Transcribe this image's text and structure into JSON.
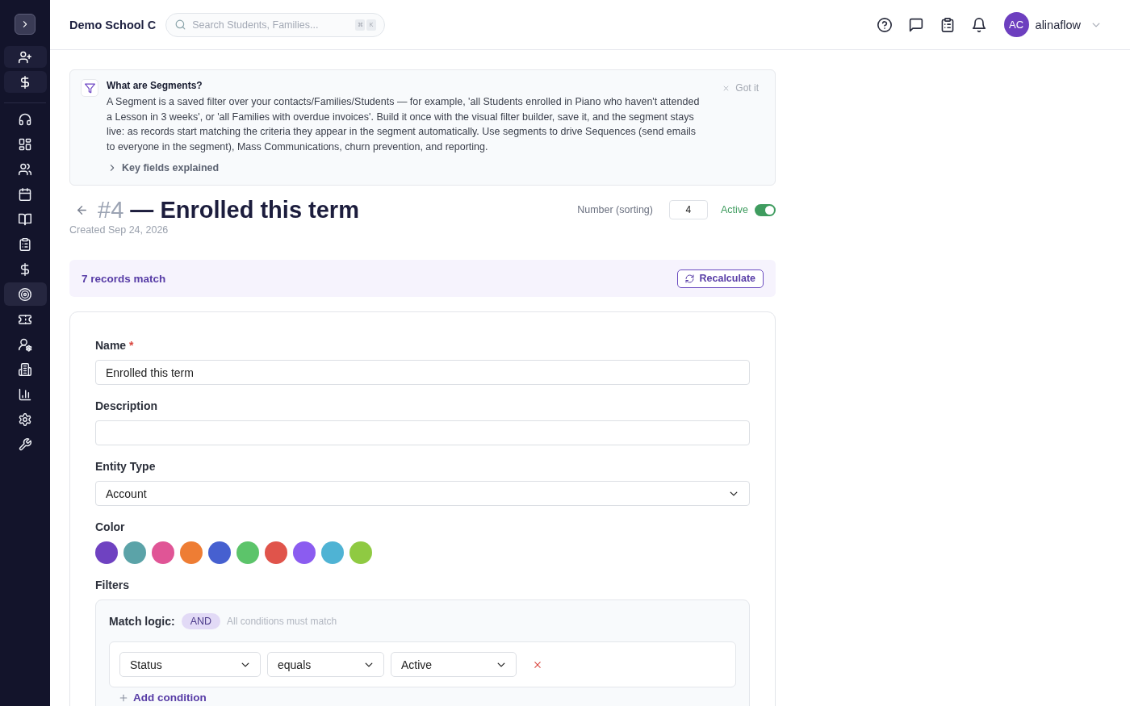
{
  "sidebar": {
    "items": [
      {
        "selected": false
      },
      {
        "selected": false
      },
      {
        "selected": false
      },
      {
        "selected": false
      },
      {
        "selected": false
      },
      {
        "selected": false
      },
      {
        "selected": false
      },
      {
        "selected": true
      },
      {
        "selected": false
      },
      {
        "selected": false
      },
      {
        "selected": false
      },
      {
        "selected": false
      },
      {
        "selected": false
      },
      {
        "selected": false
      }
    ]
  },
  "topbar": {
    "school_name": "Demo School C",
    "search": {
      "placeholder": "Search Students, Families...",
      "shortcut_keys": [
        "⌘",
        "K"
      ]
    },
    "user": {
      "initials": "AC",
      "name": "alinaflow"
    }
  },
  "info_panel": {
    "title": "What are Segments?",
    "body": "A Segment is a saved filter over your contacts/Families/Students — for example, 'all Students enrolled in Piano who haven't attended a Lesson in 3 weeks', or 'all Families with overdue invoices'. Build it once with the visual filter builder, save it, and the segment stays live: as records start matching the criteria they appear in the segment automatically. Use segments to drive Sequences (send emails to everyone in the segment), Mass Communications, churn prevention, and reporting.",
    "dismiss": "Got it",
    "details": {
      "label": "Key fields explained",
      "expanded": false
    }
  },
  "header": {
    "number": "#4",
    "title": "— Enrolled this term",
    "created": "Created Sep 24, 2026",
    "sort_number": {
      "label": "Number (sorting)",
      "value": "4"
    },
    "active": {
      "label": "Active",
      "on": true
    }
  },
  "match_bar": {
    "count_text": "7 records match",
    "button": "Recalculate"
  },
  "form": {
    "name": {
      "label": "Name",
      "required_mark": "*",
      "value": "Enrolled this term"
    },
    "description": {
      "label": "Description"
    },
    "entity_type": {
      "label": "Entity Type",
      "value": "Account"
    },
    "color": {
      "label": "Color",
      "swatches": [
        {
          "color": "#6f42c1",
          "selected": false
        },
        {
          "color": "#5ba3a8",
          "selected": false
        },
        {
          "color": "#e05596",
          "selected": false
        },
        {
          "color": "#ee7d34",
          "selected": false
        },
        {
          "color": "#4660d0",
          "selected": false
        },
        {
          "color": "#5cc46a",
          "selected": false
        },
        {
          "color": "#e0544b",
          "selected": false
        },
        {
          "color": "#8b5cf0",
          "selected": false
        },
        {
          "color": "#4fb3d4",
          "selected": false
        },
        {
          "color": "#8fca42",
          "selected": false
        }
      ]
    },
    "filters": {
      "label": "Filters",
      "match_logic": {
        "label": "Match logic:",
        "value": "AND",
        "hint": "All conditions must match"
      },
      "conditions": [
        {
          "field": "Status",
          "operator": "equals",
          "value": "Active"
        }
      ],
      "add_button": "Add condition"
    }
  }
}
